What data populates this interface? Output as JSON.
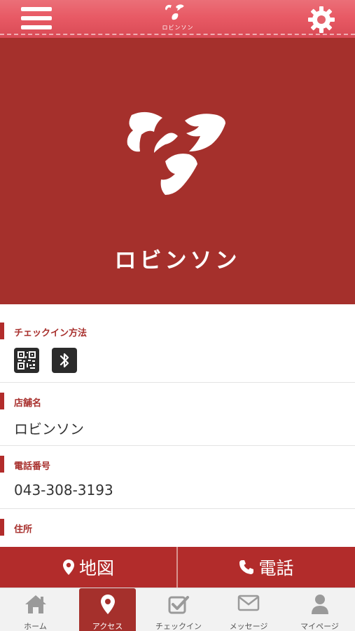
{
  "header": {
    "logo_text": "ロビンソン",
    "menu_icon": "hamburger-menu-icon",
    "settings_icon": "gear-icon"
  },
  "hero": {
    "brand_name": "ロビンソン"
  },
  "sections": {
    "checkin": {
      "title": "チェックイン方法",
      "icons": [
        "qr-code-icon",
        "bluetooth-icon"
      ]
    },
    "store": {
      "title": "店舗名",
      "value": "ロビンソン"
    },
    "phone": {
      "title": "電話番号",
      "value": "043-308-3193"
    },
    "address": {
      "title": "住所"
    }
  },
  "actions": {
    "map_label": "地図",
    "call_label": "電話"
  },
  "tabs": [
    {
      "label": "ホーム",
      "icon": "home-icon"
    },
    {
      "label": "アクセス",
      "icon": "map-pin-icon"
    },
    {
      "label": "チェックイン",
      "icon": "checkbox-icon"
    },
    {
      "label": "メッセージ",
      "icon": "envelope-icon"
    },
    {
      "label": "マイページ",
      "icon": "user-icon"
    }
  ],
  "colors": {
    "brand_red": "#a5302c",
    "accent_red": "#b22c2b",
    "header_pink": "#e85a65"
  }
}
